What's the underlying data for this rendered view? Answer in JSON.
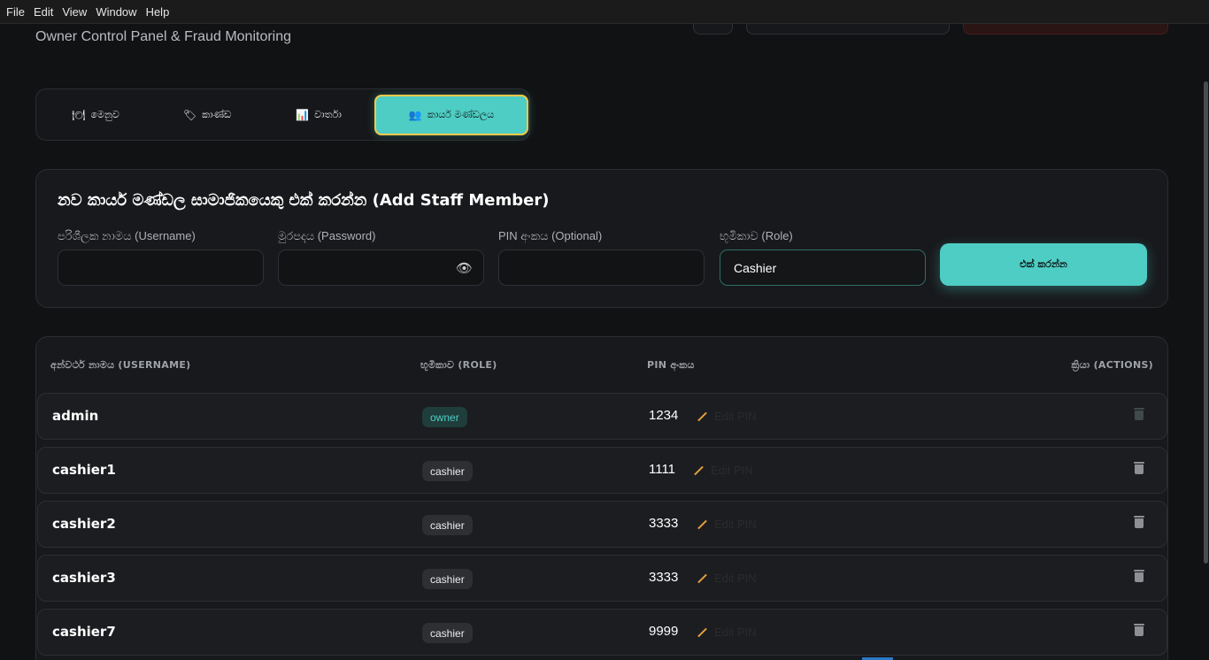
{
  "menu": [
    "File",
    "Edit",
    "View",
    "Window",
    "Help"
  ],
  "header": {
    "subtitle": "Owner Control Panel & Fraud Monitoring"
  },
  "tabs": [
    {
      "icon": "🍽",
      "label": "මෙනුව"
    },
    {
      "icon": "🏷",
      "label": "කාණ්ඩ"
    },
    {
      "icon": "📊",
      "label": "වාර්තා"
    },
    {
      "icon": "👥",
      "label": "කාර්ය මණ්ඩලය"
    }
  ],
  "active_tab": 3,
  "add_staff": {
    "title": "නව කාර්ය මණ්ඩල සාමාජිකයෙකු එක් කරන්න (Add Staff Member)",
    "username_label": "පරිශීලක නාමය (Username)",
    "password_label": "මුරපදය (Password)",
    "pin_label": "PIN අංකය (Optional)",
    "role_label": "භූමිකාව (Role)",
    "role_value": "Cashier",
    "submit_label": "එක් කරන්න"
  },
  "table": {
    "headers": {
      "username": "අන්වර්ථ නාමය (USERNAME)",
      "role": "භූමිකාව (ROLE)",
      "pin": "PIN අංකය",
      "actions": "ක්‍රියා (ACTIONS)"
    },
    "edit_pin_label": "Edit PIN",
    "rows": [
      {
        "username": "admin",
        "role": "owner",
        "pin": "1234"
      },
      {
        "username": "cashier1",
        "role": "cashier",
        "pin": "1111"
      },
      {
        "username": "cashier2",
        "role": "cashier",
        "pin": "3333"
      },
      {
        "username": "cashier3",
        "role": "cashier",
        "pin": "3333"
      },
      {
        "username": "cashier7",
        "role": "cashier",
        "pin": "9999"
      }
    ]
  },
  "colors": {
    "accent": "#4ecdc4",
    "active_tab_border": "#f2c94c",
    "pencil": "#e2a03f"
  }
}
